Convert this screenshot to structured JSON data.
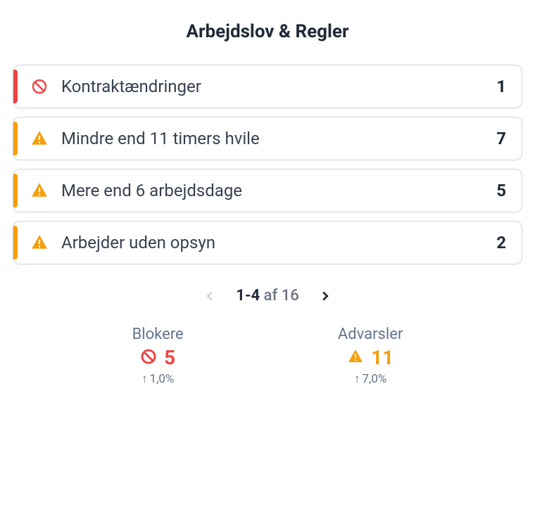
{
  "title": "Arbejdslov & Regler",
  "rules": [
    {
      "type": "block",
      "label": "Kontraktændringer",
      "count": "1"
    },
    {
      "type": "warn",
      "label": "Mindre end 11 timers hvile",
      "count": "7"
    },
    {
      "type": "warn",
      "label": "Mere end 6 arbejdsdage",
      "count": "5"
    },
    {
      "type": "warn",
      "label": "Arbejder uden opsyn",
      "count": "2"
    }
  ],
  "pagination": {
    "range": "1-4",
    "of_word": "af",
    "total": "16"
  },
  "stats": {
    "block": {
      "label": "Blokere",
      "value": "5",
      "trend": "1,0%"
    },
    "warn": {
      "label": "Advarsler",
      "value": "11",
      "trend": "7,0%"
    }
  }
}
